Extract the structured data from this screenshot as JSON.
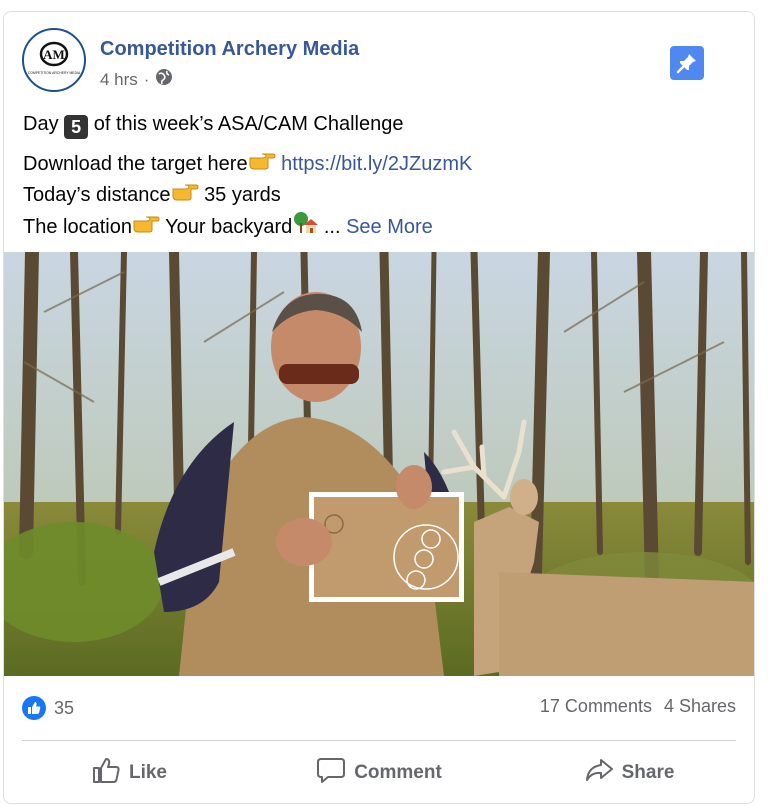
{
  "post": {
    "page_name": "Competition Archery Media",
    "time": "4 hrs",
    "separator": "·",
    "avatar_text": "AM",
    "avatar_caption": "COMPETITION ARCHERY MEDIA",
    "line1_prefix": "Day",
    "line1_number": "5",
    "line1_suffix": "of this week’s ASA/CAM Challenge",
    "line2_prefix": "Download the target here",
    "line2_link": "https://bit.ly/2JZuzmK",
    "line3_prefix": "Today’s distance",
    "line3_value": "35 yards",
    "line4_prefix": "The location",
    "line4_value": "Your backyard",
    "ellipsis": "...",
    "see_more": "See More"
  },
  "stats": {
    "likes": "35",
    "comments": "17 Comments",
    "shares": "4 Shares"
  },
  "actions": {
    "like": "Like",
    "comment": "Comment",
    "share": "Share"
  },
  "icons": {
    "globe": "globe-icon",
    "pin": "pin-icon",
    "thumbs_up": "thumbs-up-icon",
    "comment": "comment-icon",
    "share": "share-icon"
  },
  "colors": {
    "link": "#385898",
    "accent": "#1877f2",
    "pin_bg": "#4e88f0"
  }
}
